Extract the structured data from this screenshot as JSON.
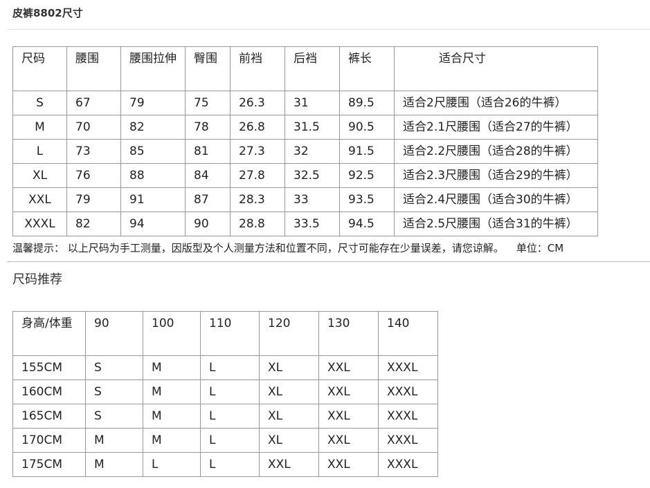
{
  "page_title": "皮裤8802尺寸",
  "size_table": {
    "headers": [
      "尺码",
      "腰围",
      "腰围拉伸",
      "臀围",
      "前裆",
      "后裆",
      "裤长",
      "适合尺寸"
    ],
    "rows": [
      [
        "S",
        "67",
        "79",
        "75",
        "26.3",
        "31",
        "89.5",
        "适合2尺腰围（适合26的牛裤）"
      ],
      [
        "M",
        "70",
        "82",
        "78",
        "26.8",
        "31.5",
        "90.5",
        "适合2.1尺腰围（适合27的牛裤）"
      ],
      [
        "L",
        "73",
        "85",
        "81",
        "27.3",
        "32",
        "91.5",
        "适合2.2尺腰围（适合28的牛裤）"
      ],
      [
        "XL",
        "76",
        "88",
        "84",
        "27.8",
        "32.5",
        "92.5",
        "适合2.3尺腰围（适合29的牛裤）"
      ],
      [
        "XXL",
        "79",
        "91",
        "87",
        "28.3",
        "33",
        "93.5",
        "适合2.4尺腰围（适合30的牛裤）"
      ],
      [
        "XXXL",
        "82",
        "94",
        "90",
        "28.8",
        "33.5",
        "94.5",
        "适合2.5尺腰围（适合31的牛裤）"
      ]
    ]
  },
  "note": {
    "text": "温馨提示： 以上尺码为手工测量，因版型及个人测量方法和位置不同，尺寸可能存在少量误差，请您谅解。",
    "unit": "单位：CM"
  },
  "recommend_section": {
    "title": "尺码推荐",
    "headers": [
      "身高/体重",
      "90",
      "100",
      "110",
      "120",
      "130",
      "140"
    ],
    "rows": [
      [
        "155CM",
        "S",
        "M",
        "L",
        "XL",
        "XXL",
        "XXXL"
      ],
      [
        "160CM",
        "S",
        "M",
        "L",
        "XL",
        "XXL",
        "XXXL"
      ],
      [
        "165CM",
        "S",
        "M",
        "L",
        "XL",
        "XXL",
        "XXXL"
      ],
      [
        "170CM",
        "M",
        "M",
        "L",
        "XL",
        "XXL",
        "XXXL"
      ],
      [
        "175CM",
        "M",
        "L",
        "L",
        "XXL",
        "XXL",
        "XXXL"
      ]
    ]
  }
}
